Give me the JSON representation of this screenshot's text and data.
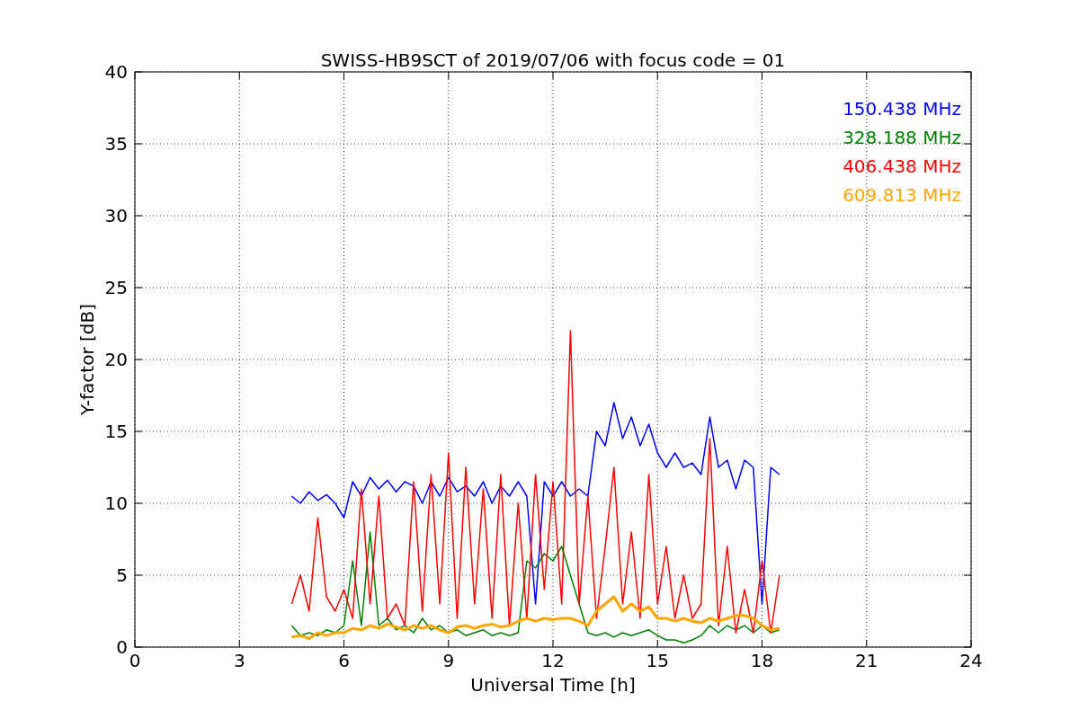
{
  "chart_data": {
    "type": "line",
    "title": "SWISS-HB9SCT of 2019/07/06 with focus code = 01",
    "xlabel": "Universal Time [h]",
    "ylabel": "Y-factor [dB]",
    "x": [
      4.5,
      4.75,
      5,
      5.25,
      5.5,
      5.75,
      6,
      6.25,
      6.5,
      6.75,
      7,
      7.25,
      7.5,
      7.75,
      8,
      8.25,
      8.5,
      8.75,
      9,
      9.25,
      9.5,
      9.75,
      10,
      10.25,
      10.5,
      10.75,
      11,
      11.25,
      11.5,
      11.75,
      12,
      12.25,
      12.5,
      12.75,
      13,
      13.25,
      13.5,
      13.75,
      14,
      14.25,
      14.5,
      14.75,
      15,
      15.25,
      15.5,
      15.75,
      16,
      16.25,
      16.5,
      16.75,
      17,
      17.25,
      17.5,
      17.75,
      18,
      18.25,
      18.5
    ],
    "series": [
      {
        "name": "150.438 MHz",
        "color": "#0000ff",
        "values": [
          10.5,
          10,
          10.8,
          10.2,
          10.6,
          10,
          9,
          11.5,
          10.5,
          11.8,
          11,
          11.6,
          10.8,
          11.5,
          11.2,
          10,
          11.5,
          10.5,
          11.8,
          10.8,
          11.2,
          10.5,
          11.5,
          10,
          11.2,
          10.5,
          11.5,
          10.5,
          3,
          11.5,
          10.5,
          11.5,
          10.5,
          11,
          10.5,
          15,
          14,
          17,
          14.5,
          16,
          14,
          15.5,
          13.5,
          12.5,
          13.5,
          12.5,
          12.8,
          12,
          16,
          12.5,
          13,
          11,
          13,
          12.5,
          3,
          12.5,
          12
        ]
      },
      {
        "name": "328.188 MHz",
        "color": "#008000",
        "values": [
          1.5,
          0.8,
          1,
          0.8,
          1.2,
          1,
          1.5,
          6,
          1.5,
          8,
          1.5,
          2,
          1.2,
          1.5,
          1,
          2,
          1.2,
          1.5,
          1,
          1.2,
          0.8,
          1,
          1.2,
          0.8,
          1,
          0.8,
          1,
          6,
          5.5,
          6.5,
          6,
          7,
          5,
          3,
          1,
          0.8,
          1,
          0.7,
          1,
          0.8,
          1,
          1.2,
          0.8,
          0.5,
          0.5,
          0.3,
          0.5,
          0.8,
          1.5,
          1,
          1.5,
          1.2,
          1.5,
          1,
          1.5,
          1,
          1.2
        ]
      },
      {
        "name": "406.438 MHz",
        "color": "#ff0000",
        "values": [
          3,
          5,
          2.5,
          9,
          3.5,
          2.5,
          4,
          2,
          11,
          3,
          10.5,
          2,
          3,
          1.5,
          11.5,
          2.5,
          12,
          3,
          13.5,
          2,
          12.5,
          3,
          11,
          2,
          12,
          1.5,
          10,
          2,
          12,
          4,
          11.5,
          3,
          22,
          3,
          10.5,
          2,
          7,
          12.5,
          3,
          8,
          2,
          12,
          3,
          7,
          2,
          5,
          2,
          3,
          14.5,
          1.5,
          7,
          1,
          4,
          1,
          6,
          1,
          5
        ]
      },
      {
        "name": "609.813 MHz",
        "color": "#ffa500",
        "values": [
          0.7,
          0.8,
          0.6,
          1,
          0.8,
          1,
          1,
          1.3,
          1.2,
          1.5,
          1.3,
          1.6,
          1.4,
          1.2,
          1.5,
          1.3,
          1.5,
          1.2,
          1,
          1.4,
          1.5,
          1.3,
          1.5,
          1.6,
          1.4,
          1.5,
          1.8,
          2,
          1.8,
          2,
          1.9,
          2,
          2,
          1.8,
          1.5,
          2.5,
          3,
          3.5,
          2.5,
          3,
          2.5,
          2.8,
          2,
          2,
          1.8,
          2,
          1.8,
          1.7,
          2,
          1.8,
          2,
          2.2,
          2.2,
          2,
          1.5,
          1.2,
          1.3
        ]
      }
    ],
    "xlim": [
      0,
      24
    ],
    "ylim": [
      0,
      40
    ],
    "xticks": [
      0,
      3,
      6,
      9,
      12,
      15,
      18,
      21,
      24
    ],
    "yticks": [
      0,
      5,
      10,
      15,
      20,
      25,
      30,
      35,
      40
    ],
    "grid": true
  }
}
